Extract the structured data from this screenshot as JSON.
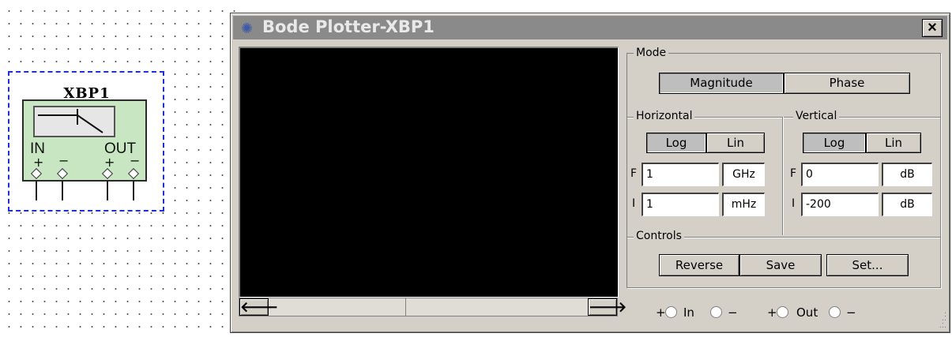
{
  "schematic": {
    "instrument_ref": "XBP1",
    "in_label": "IN",
    "out_label": "OUT",
    "plus": "+",
    "minus": "−"
  },
  "window": {
    "title": "Bode Plotter-XBP1",
    "close_label": "×"
  },
  "scrollbar": {
    "left_arrow": "🡐",
    "right_arrow": "🡒"
  },
  "mode": {
    "label": "Mode",
    "magnitude": "Magnitude",
    "phase": "Phase",
    "selected": "Magnitude"
  },
  "horizontal": {
    "label": "Horizontal",
    "log": "Log",
    "lin": "Lin",
    "selected": "Log",
    "final_label": "F",
    "initial_label": "I",
    "final_value": "1",
    "final_unit": "GHz",
    "initial_value": "1",
    "initial_unit": "mHz"
  },
  "vertical": {
    "label": "Vertical",
    "log": "Log",
    "lin": "Lin",
    "selected": "Log",
    "final_label": "F",
    "initial_label": "I",
    "final_value": "0",
    "final_unit": "dB",
    "initial_value": "-200",
    "initial_unit": "dB"
  },
  "controls": {
    "label": "Controls",
    "reverse": "Reverse",
    "save": "Save",
    "set": "Set..."
  },
  "terminals": {
    "in_plus": "+",
    "in_label": "In",
    "in_minus": "−",
    "out_plus": "+",
    "out_label": "Out",
    "out_minus": "−"
  },
  "colors": {
    "title_bar": "#8a8a8a",
    "window_face": "#d4d0c8",
    "plot_background": "#000000",
    "symbol_fill": "#c8e6c1",
    "selection_border": "#1d2fd8"
  }
}
